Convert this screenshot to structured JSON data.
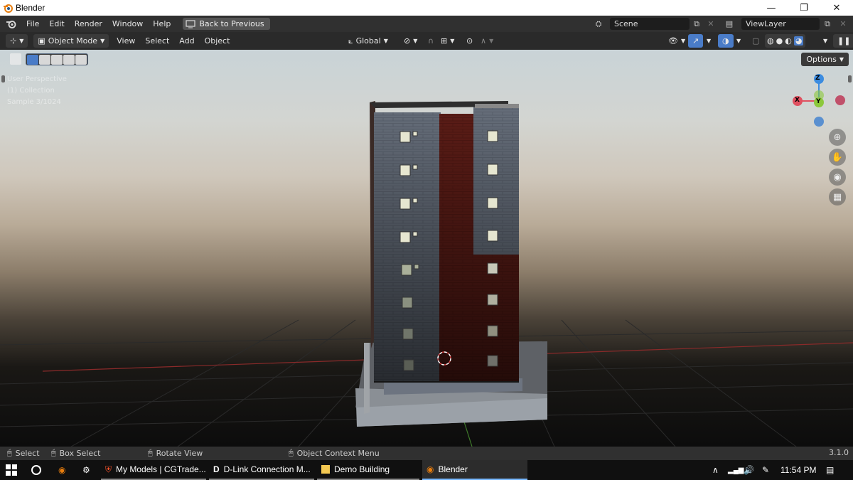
{
  "window": {
    "title": "Blender"
  },
  "topbar": {
    "menus": [
      "File",
      "Edit",
      "Render",
      "Window",
      "Help"
    ],
    "back_label": "Back to Previous",
    "scene": "Scene",
    "view_layer": "ViewLayer"
  },
  "viewport_header": {
    "mode": "Object Mode",
    "menus": [
      "View",
      "Select",
      "Add",
      "Object"
    ],
    "transform_orientation": "Global"
  },
  "viewport": {
    "perspective": "User Perspective",
    "collection": "(1) Collection",
    "sample": "Sample 3/1024",
    "options_label": "Options",
    "gizmo": {
      "z": "Z",
      "x": "X",
      "y": "Y"
    }
  },
  "statusbar": {
    "select": "Select",
    "box_select": "Box Select",
    "rotate": "Rotate View",
    "context_menu": "Object Context Menu",
    "version": "3.1.0"
  },
  "taskbar": {
    "tasks": [
      "My Models | CGTrade...",
      "D-Link Connection M...",
      "Demo Building",
      "Blender"
    ],
    "time": "11:54 PM"
  },
  "colors": {
    "accent": "#4a7cc8",
    "gizmo_x": "#e05060",
    "gizmo_y": "#8cc83c",
    "gizmo_z": "#3c8ce0"
  }
}
